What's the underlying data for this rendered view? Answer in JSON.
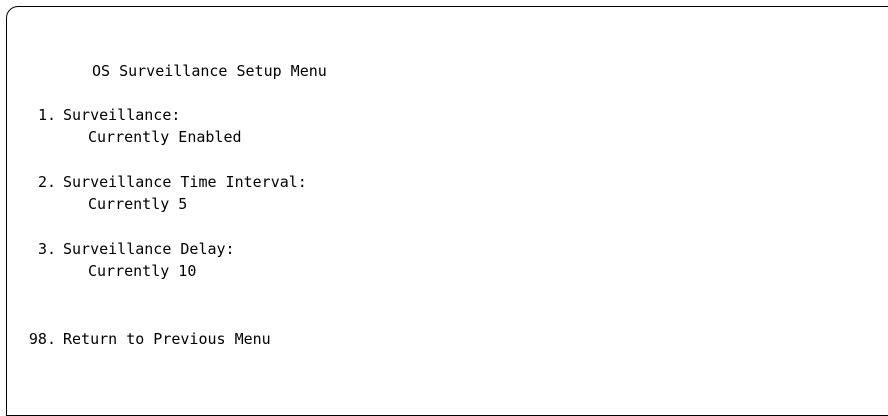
{
  "menu": {
    "title": "OS Surveillance Setup Menu",
    "options": [
      {
        "number": "1.",
        "label": "Surveillance:",
        "value": "Currently Enabled"
      },
      {
        "number": "2.",
        "label": "Surveillance Time Interval:",
        "value": "Currently 5"
      },
      {
        "number": "3.",
        "label": "Surveillance Delay:",
        "value": "Currently 10"
      }
    ],
    "return_option": {
      "number": "98.",
      "label": "Return to Previous Menu"
    }
  }
}
